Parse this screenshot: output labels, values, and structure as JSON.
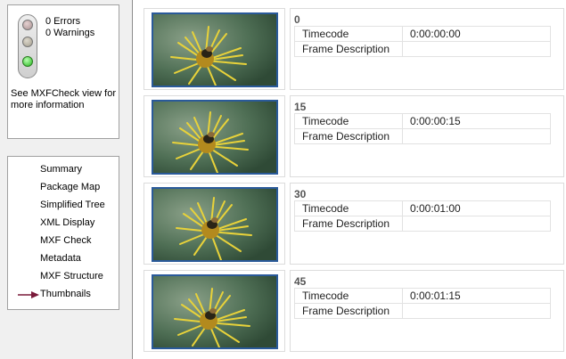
{
  "status": {
    "errors_text": "0 Errors",
    "warnings_text": "0 Warnings",
    "message": "See MXFCheck view for more information"
  },
  "nav": {
    "items": [
      "Summary",
      "Package Map",
      "Simplified Tree",
      "XML Display",
      "MXF Check",
      "Metadata",
      "MXF Structure",
      "Thumbnails"
    ],
    "selected": "Thumbnails",
    "selected_indicator": "arrow-right-icon"
  },
  "thumbnails": {
    "field_labels": {
      "timecode": "Timecode",
      "description": "Frame Description"
    },
    "frames": [
      {
        "frame": "0",
        "timecode": "0:00:00:00",
        "description": ""
      },
      {
        "frame": "15",
        "timecode": "0:00:00:15",
        "description": ""
      },
      {
        "frame": "30",
        "timecode": "0:00:01:00",
        "description": ""
      },
      {
        "frame": "45",
        "timecode": "0:00:01:15",
        "description": ""
      }
    ]
  },
  "colors": {
    "thumb_border": "#2a5a9a",
    "arrow": "#7a1a3a",
    "status_ok": "#22b61a"
  }
}
